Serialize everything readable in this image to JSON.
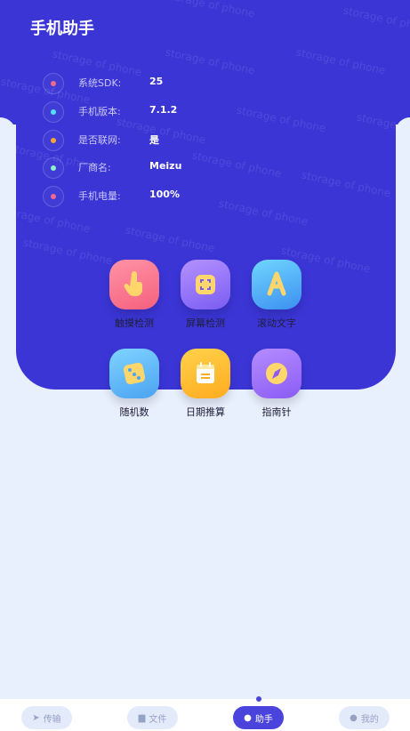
{
  "header": {
    "title": "手机助手"
  },
  "watermark": "storage of phone",
  "info": [
    {
      "label": "系统SDK:",
      "value": "25",
      "dot_color": "#f06a8e"
    },
    {
      "label": "手机版本:",
      "value": "7.1.2",
      "dot_color": "#4fe0f5"
    },
    {
      "label": "是否联网:",
      "value": "是",
      "dot_color": "#f7a433"
    },
    {
      "label": "厂商名:",
      "value": "Meizu",
      "dot_color": "#8ef0c8"
    },
    {
      "label": "手机电量:",
      "value": "100%",
      "dot_color": "#f06a8e"
    }
  ],
  "tools": [
    {
      "label": "触摸检测",
      "icon": "touch-hand-icon"
    },
    {
      "label": "屏幕检测",
      "icon": "screen-frame-icon"
    },
    {
      "label": "滚动文字",
      "icon": "letter-a-icon"
    },
    {
      "label": "随机数",
      "icon": "dice-icon"
    },
    {
      "label": "日期推算",
      "icon": "calendar-icon"
    },
    {
      "label": "指南针",
      "icon": "compass-icon"
    }
  ],
  "nav": [
    {
      "label": "传输",
      "icon": "send-icon",
      "active": false
    },
    {
      "label": "文件",
      "icon": "folder-icon",
      "active": false
    },
    {
      "label": "助手",
      "icon": "assistant-icon",
      "active": true
    },
    {
      "label": "我的",
      "icon": "user-icon",
      "active": false
    }
  ]
}
